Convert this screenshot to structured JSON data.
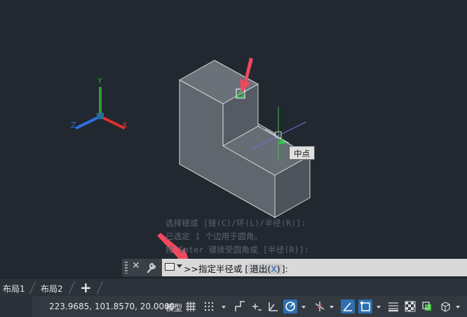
{
  "colors": {
    "viewport_bg": "#212830",
    "axis_x": "#e03030",
    "axis_y": "#2fa02f",
    "axis_z": "#2f6fe0",
    "highlight_arrow": "#f04860",
    "snap_marker": "#2cc84a",
    "active_toggle": "#2f6fb0"
  },
  "ucs_icon": {
    "x_label": "X",
    "y_label": "Y",
    "z_label": "Z"
  },
  "snap_tooltip": "中点",
  "command_history": [
    "选择链或 [链(C)/环(L)/半径(R)]:",
    "已选定 1 个边用于圆角。",
    "按 Enter 键接受圆角或 [半径(R)]:"
  ],
  "command_line": {
    "prompt": ">>指定半径或 [",
    "option_label": "退出(",
    "option_key": "X",
    "option_close": ")",
    "suffix": "]:",
    "icons": [
      "close-icon",
      "wrench-icon",
      "console-icon"
    ]
  },
  "layout_tabs": [
    "布局1",
    "布局2"
  ],
  "add_tab_label": "+",
  "status_bar": {
    "coordinates": "223.9685, 101.8570, 20.0000",
    "model_label": "模型",
    "toggles": [
      "grid-icon",
      "snap-icon",
      "ortho-icon",
      "infer-icon",
      "polar-icon",
      "osnap-track-icon",
      "isodraft-icon",
      "dynamic-ucs-icon",
      "selection-cycle-icon",
      "lineweight-icon",
      "transparency-icon",
      "annotation-icon",
      "workspace-icon"
    ]
  }
}
